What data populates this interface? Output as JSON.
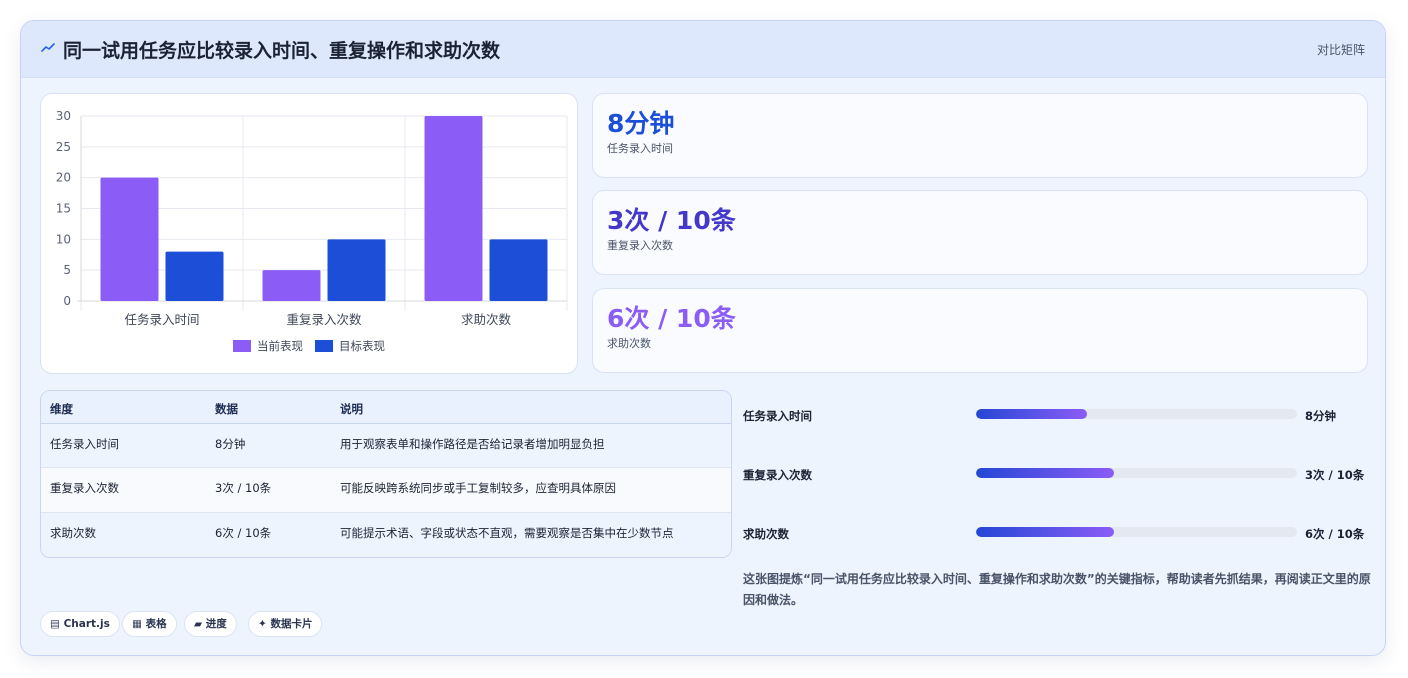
{
  "header": {
    "icon": "trend-line-icon",
    "title": "同一试用任务应比较录入时间、重复操作和求助次数",
    "tag": "对比矩阵"
  },
  "colors": {
    "current": "#8b5cf6",
    "target": "#1d4ed8",
    "kpi_values": [
      "#1d4ed8",
      "#4338ca",
      "#8b5cf6"
    ]
  },
  "chart_data": {
    "type": "bar",
    "categories": [
      "任务录入时间",
      "重复录入次数",
      "求助次数"
    ],
    "series": [
      {
        "name": "当前表现",
        "values": [
          20,
          5,
          30
        ]
      },
      {
        "name": "目标表现",
        "values": [
          8,
          10,
          10
        ]
      }
    ],
    "title": "",
    "xlabel": "",
    "ylabel": "",
    "ylim": [
      0,
      30
    ],
    "yticks": [
      0,
      5,
      10,
      15,
      20,
      25,
      30
    ],
    "grid": true,
    "legend": "bottom"
  },
  "kpis": [
    {
      "value": "8分钟",
      "label": "任务录入时间"
    },
    {
      "value": "3次 / 10条",
      "label": "重复录入次数"
    },
    {
      "value": "6次 / 10条",
      "label": "求助次数"
    }
  ],
  "table": {
    "headers": [
      "维度",
      "数据",
      "说明"
    ],
    "rows": [
      [
        "任务录入时间",
        "8分钟",
        "用于观察表单和操作路径是否给记录者增加明显负担"
      ],
      [
        "重复录入次数",
        "3次 / 10条",
        "可能反映跨系统同步或手工复制较多，应查明具体原因"
      ],
      [
        "求助次数",
        "6次 / 10条",
        "可能提示术语、字段或状态不直观，需要观察是否集中在少数节点"
      ]
    ]
  },
  "progress": [
    {
      "label": "任务录入时间",
      "value": "8分钟",
      "fraction": 0.345
    },
    {
      "label": "重复录入次数",
      "value": "3次 / 10条",
      "fraction": 0.43
    },
    {
      "label": "求助次数",
      "value": "6次 / 10条",
      "fraction": 0.43
    }
  ],
  "summary": "这张图提炼“同一试用任务应比较录入时间、重复操作和求助次数”的关键指标，帮助读者先抓结果，再阅读正文里的原因和做法。",
  "pills": [
    {
      "icon": "chart-icon",
      "glyph": "▤",
      "label": "Chart.js"
    },
    {
      "icon": "table-icon",
      "glyph": "▦",
      "label": "表格"
    },
    {
      "icon": "progress-icon",
      "glyph": "▰",
      "label": "进度"
    },
    {
      "icon": "sparkle-icon",
      "glyph": "✦",
      "label": "数据卡片"
    }
  ]
}
